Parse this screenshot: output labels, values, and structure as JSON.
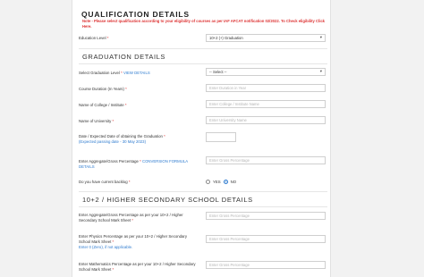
{
  "page_title": "QUALIFICATION DETAILS",
  "note": "Note - Please select qualification according to your eligibility of courses as per IAF AFCAT notification 02/2022. To Check eligibility Click Here.",
  "education_level": {
    "label": "Education Level",
    "value": "10+2 (+) Graduation",
    "arrow": "▾"
  },
  "graduation_section": {
    "title": "GRADUATION DETAILS",
    "select_grad_level": {
      "label": "Select Graduation Level",
      "link": "VIEW DETAILS",
      "value": "-- Select --",
      "arrow": "▾"
    },
    "course_duration": {
      "label": "Course Duration (In Years)",
      "placeholder": "Enter Duration in Year"
    },
    "college_name": {
      "label": "Name of College / Institute",
      "placeholder": "Enter College / Institute Name"
    },
    "university_name": {
      "label": "Name of University",
      "placeholder": "Enter University Name"
    },
    "graduation_date": {
      "label": "Date / Expected Date of obtaining the Graduation",
      "hint": "(Expected passing date - 30 May 2023)"
    },
    "aggregate_percentage": {
      "label": "Enter Aggregate/Gross Percentage",
      "link": "CONVERSION FORMULA DETAILS",
      "placeholder": "Enter Gross Percentage"
    },
    "backlog": {
      "label": "Do you have current backlog",
      "options": [
        "YES",
        "NO"
      ],
      "selected": "NO"
    }
  },
  "higher_secondary_section": {
    "title": "10+2 / HIGHER SECONDARY SCHOOL DETAILS",
    "aggregate": {
      "label": "Enter Aggregate/Gross Percentage as per your 10+2 / Higher Secondary School Mark Sheet",
      "placeholder": "Enter Gross Percentage"
    },
    "physics": {
      "label": "Enter Physics Percentage as per your 10+2 / Higher Secondary School Mark Sheet",
      "hint": "Enter 0 (Zero), if not applicable.",
      "placeholder": "Enter Gross Percentage"
    },
    "maths": {
      "label": "Enter Mathematics Percentage as per your 10+2 / Higher Secondary School Mark Sheet",
      "placeholder": "Enter Gross Percentage"
    }
  },
  "required_mark": "*"
}
